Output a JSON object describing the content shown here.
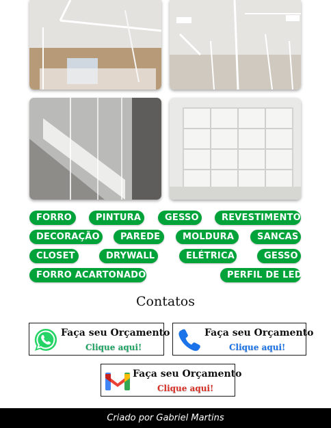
{
  "gallery": {
    "photos": [
      {
        "alt": "LED ceiling photo"
      },
      {
        "alt": "LED ceiling lines photo"
      },
      {
        "alt": "Staircase photo"
      },
      {
        "alt": "Shelving photo"
      }
    ]
  },
  "tags": [
    "FORRO",
    "PINTURA",
    "GESSO",
    "REVESTIMENTO",
    "DECORAÇÃO",
    "PAREDE",
    "MOLDURA",
    "SANCAS",
    "CLOSET",
    "DRYWALL",
    "ELÉTRICA",
    "GESSO",
    "FORRO ACARTONADO",
    "PERFIL DE LED"
  ],
  "contacts": {
    "title": "Contatos",
    "whatsapp": {
      "label": "Faça seu Orçamento",
      "cta": "Clique aqui!",
      "cta_color": "#1fa463",
      "icon": "whatsapp-icon"
    },
    "phone": {
      "label": "Faça seu Orçamento",
      "cta": "Clique aqui!",
      "cta_color": "#1a73e8",
      "icon": "phone-icon"
    },
    "gmail": {
      "label": "Faça seu Orçamento",
      "cta": "Clique aqui!",
      "cta_color": "#d93025",
      "icon": "gmail-icon"
    }
  },
  "footer": {
    "text": "Criado por Gabriel Martins"
  },
  "colors": {
    "tag_bg": "#00a33a",
    "footer_bg": "#000000"
  }
}
